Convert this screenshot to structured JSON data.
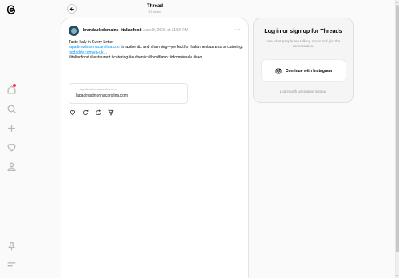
{
  "header": {
    "title": "Thread",
    "views": "37 views"
  },
  "post": {
    "username": "brandabledomains",
    "separator": "›",
    "topic": "italianfood",
    "date": "June 8, 2025 at 11:50 PM",
    "more": "···",
    "line1": "Taste Italy in Every Letter",
    "link1": "lapadinadinonnacarolina.com",
    "line2": " is authentic and charming—perfect for Italian restaurants or catering.",
    "link2": "godaddy.com/en-uk…",
    "hashtags": "#italianfood #restaurant #catering #authentic #localflavor #domainsale #seo",
    "card_small": "lapadinadinonnacarolina.com",
    "card_main": "lapadinadinonnacarolina.com"
  },
  "login": {
    "title": "Log in or sign up for Threads",
    "subtitle": "See what people are talking about and join the conversation.",
    "instagram_button": "Continue with Instagram",
    "alt": "Log in with username instead"
  },
  "icons": {
    "rail": [
      "threads-logo-icon",
      "home-icon",
      "search-icon",
      "create-icon",
      "activity-heart-icon",
      "profile-icon",
      "pin-icon",
      "menu-icon"
    ],
    "actions": [
      "like-icon",
      "reply-icon",
      "repost-icon",
      "share-icon"
    ]
  },
  "colors": {
    "link": "#0095f6",
    "notification": "#ff3040"
  }
}
